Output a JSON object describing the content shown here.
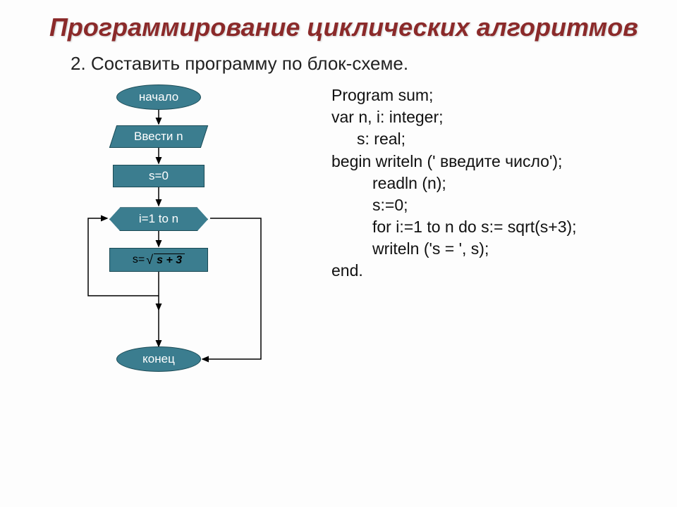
{
  "title": "Программирование циклических алгоритмов",
  "subtitle": "2. Составить программу по блок-схеме.",
  "flowchart": {
    "start": "начало",
    "input": "Ввести n",
    "init": "s=0",
    "loop": "i=1 to n",
    "assign_prefix": "s=",
    "assign_expr": "s + 3",
    "end": "конец"
  },
  "code": {
    "l1": "Program sum;",
    "l2": "var n, i: integer;",
    "l3": "s: real;",
    "l4": "begin writeln (' введите число');",
    "l5": "readln (n);",
    "l6": "s:=0;",
    "l7": "for i:=1 to n do s:= sqrt(s+3);",
    "l8": "writeln ('s = ', s);",
    "l9": "end."
  }
}
